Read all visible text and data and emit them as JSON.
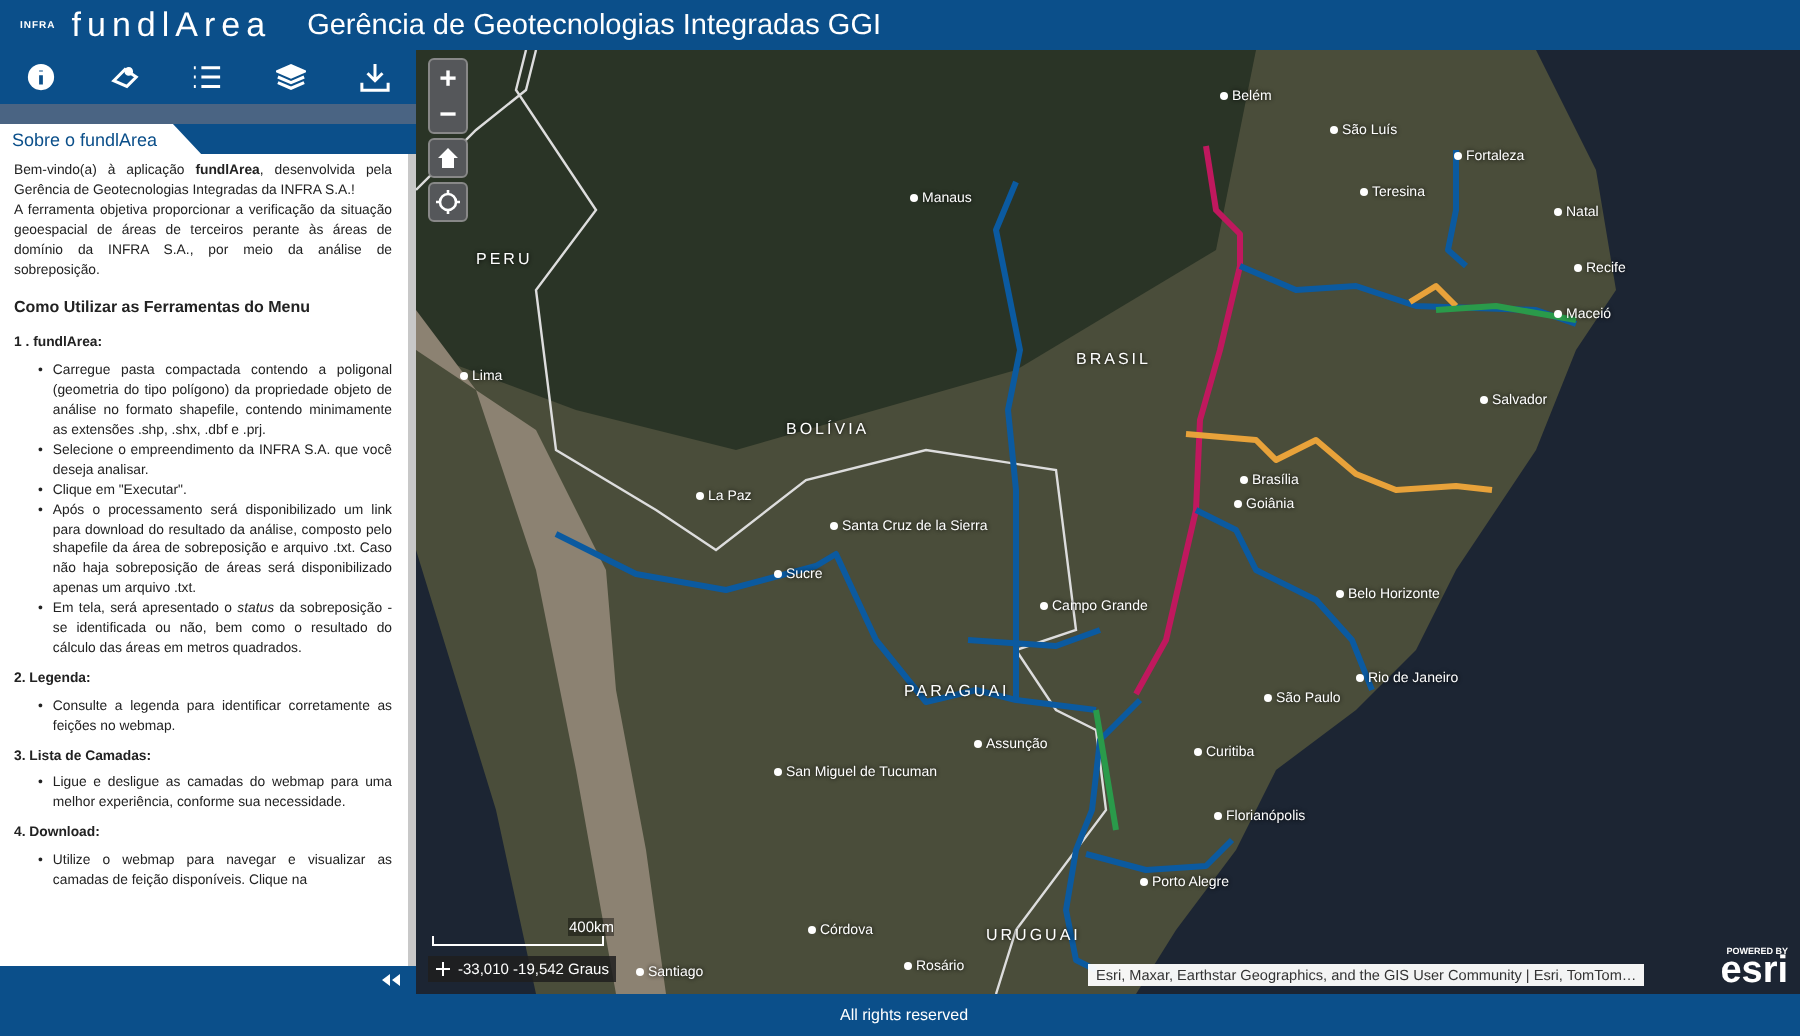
{
  "header": {
    "brand_mark": "INFRA",
    "app_name": "fundlArea",
    "title": "Gerência de Geotecnologias Integradas GGI"
  },
  "panel": {
    "tab": {
      "label": "Sobre o fundlArea",
      "selected": true
    },
    "intro": [
      "Bem-vindo(a) à aplicação **fundlArea**, desenvolvida pela Gerência de Geotecnologias Integradas da INFRA S.A.!",
      "A ferramenta objetiva proporcionar a verificação da situação geoespacial de áreas de terceiros perante às áreas de domínio da INFRA S.A., por meio da análise de sobreposição."
    ],
    "heading": "Como Utilizar as Ferramentas do Menu",
    "bullet": "•",
    "sections": [
      {
        "title": "1 . fundlArea:",
        "bullets": [
          "Carregue pasta compactada contendo a poligonal (geometria do tipo polígono) da propriedade objeto de análise no formato shapefile, contendo minimamente as extensões .shp, .shx, .dbf e .prj.",
          "Selecione o empreendimento da INFRA S.A. que você deseja analisar.",
          "Clique em \"Executar\".",
          "Após o processamento será disponibilizado um link para download do resultado da análise, composto pelo shapefile da área de sobreposição e arquivo .txt. Caso não haja sobreposição de áreas será disponibilizado apenas um arquivo .txt.",
          "Em tela, será apresentado o *status* da sobreposição - se identificada ou não, bem como o resultado do cálculo das áreas em metros quadrados."
        ]
      },
      {
        "title": "2. Legenda:",
        "bullets": [
          "Consulte a legenda para identificar corretamente as feições no webmap."
        ]
      },
      {
        "title": "3. Lista de Camadas:",
        "bullets": [
          "Ligue e desligue as camadas do webmap para uma melhor experiência, conforme sua necessidade."
        ]
      },
      {
        "title": "4. Download:",
        "bullets": [
          "Utilize o webmap para navegar e visualizar as camadas de feição disponíveis. Clique na"
        ]
      }
    ]
  },
  "map": {
    "zoom_in": "+",
    "zoom_out": "−",
    "labels": [
      {
        "text": "Manaus",
        "kind": "city"
      },
      {
        "text": "Belém",
        "kind": "city"
      },
      {
        "text": "São Luís",
        "kind": "city"
      },
      {
        "text": "Fortaleza",
        "kind": "city"
      },
      {
        "text": "Teresina",
        "kind": "city"
      },
      {
        "text": "Natal",
        "kind": "city"
      },
      {
        "text": "Recife",
        "kind": "city"
      },
      {
        "text": "Maceió",
        "kind": "city"
      },
      {
        "text": "PERU",
        "kind": "country"
      },
      {
        "text": "BRASIL",
        "kind": "country"
      },
      {
        "text": "Lima",
        "kind": "city"
      },
      {
        "text": "Salvador",
        "kind": "city"
      },
      {
        "text": "Brasília",
        "kind": "city"
      },
      {
        "text": "Goiânia",
        "kind": "city"
      },
      {
        "text": "La Paz",
        "kind": "city"
      },
      {
        "text": "BOLÍVIA",
        "kind": "country"
      },
      {
        "text": "Santa Cruz de la Sierra",
        "kind": "city"
      },
      {
        "text": "Sucre",
        "kind": "city"
      },
      {
        "text": "Belo Horizonte",
        "kind": "city"
      },
      {
        "text": "Campo Grande",
        "kind": "city"
      },
      {
        "text": "Rio de Janeiro",
        "kind": "city"
      },
      {
        "text": "São Paulo",
        "kind": "city"
      },
      {
        "text": "PARAGUAI",
        "kind": "country"
      },
      {
        "text": "Assunção",
        "kind": "city"
      },
      {
        "text": "Curitiba",
        "kind": "city"
      },
      {
        "text": "San Miguel de Tucuman",
        "kind": "city"
      },
      {
        "text": "Florianópolis",
        "kind": "city"
      },
      {
        "text": "Porto Alegre",
        "kind": "city"
      },
      {
        "text": "Córdova",
        "kind": "city"
      },
      {
        "text": "Rosário",
        "kind": "city"
      },
      {
        "text": "Santiago",
        "kind": "city"
      },
      {
        "text": "URUGUAI",
        "kind": "country"
      }
    ],
    "scale": "400km",
    "coordinates": "-33,010 -19,542 Graus",
    "attribution": "Esri, Maxar, Earthstar Geographics, and the GIS User Community | Esri, TomTom…",
    "powered_by": "POWERED BY",
    "esri": "esri"
  },
  "footer": "All rights reserved"
}
